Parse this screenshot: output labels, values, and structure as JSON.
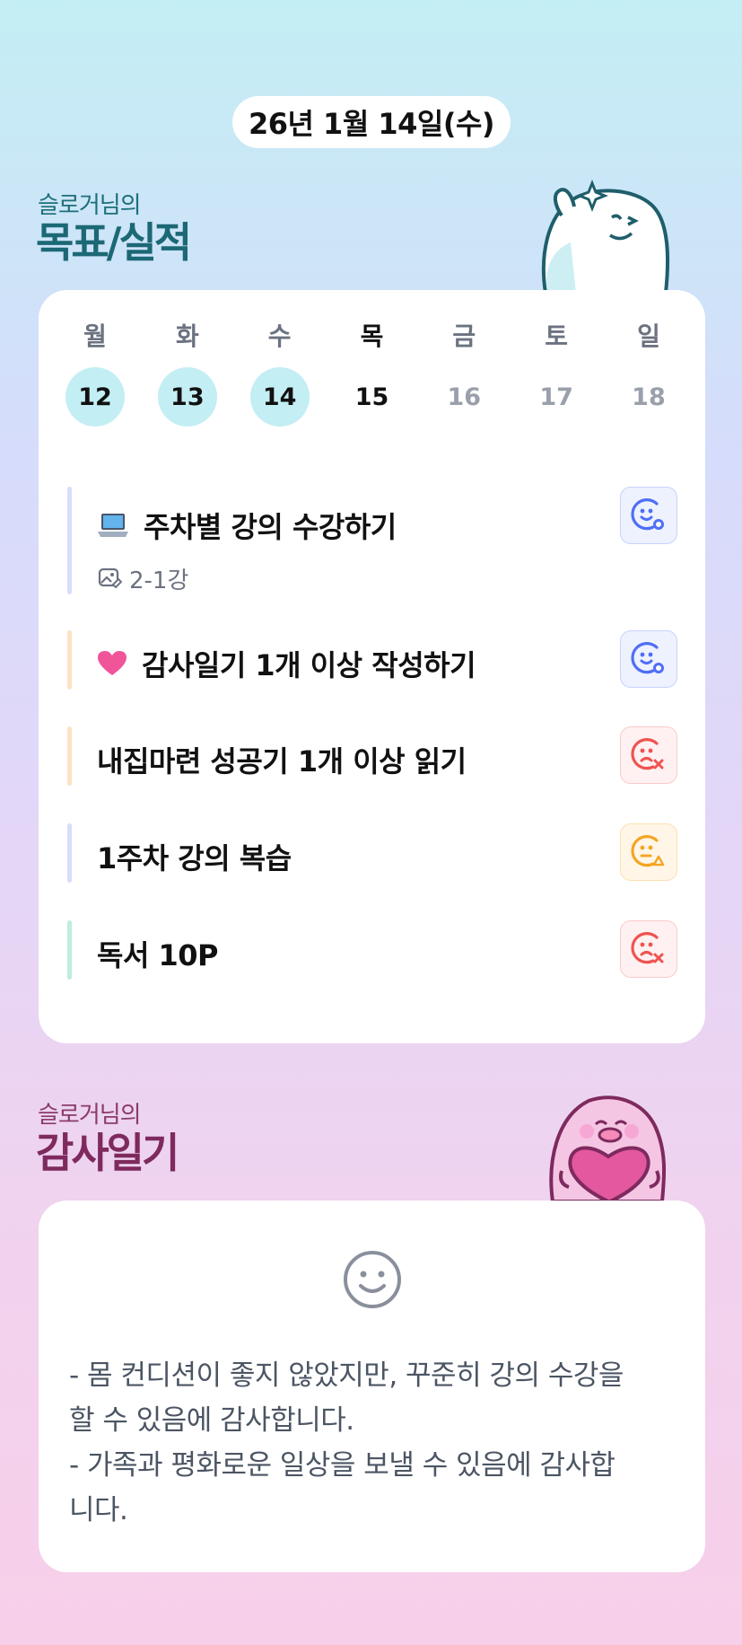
{
  "header": {
    "date": "26년 1월 14일(수)"
  },
  "goals_section": {
    "subtitle": "슬로거님의",
    "title": "목표/실적"
  },
  "week": [
    {
      "name": "월",
      "num": "12",
      "done": true,
      "current": false
    },
    {
      "name": "화",
      "num": "13",
      "done": true,
      "current": false
    },
    {
      "name": "수",
      "num": "14",
      "done": true,
      "current": false
    },
    {
      "name": "목",
      "num": "15",
      "done": false,
      "current": true
    },
    {
      "name": "금",
      "num": "16",
      "done": false,
      "current": false
    },
    {
      "name": "토",
      "num": "17",
      "done": false,
      "current": false
    },
    {
      "name": "일",
      "num": "18",
      "done": false,
      "current": false
    }
  ],
  "goals": [
    {
      "emoji": "laptop-icon",
      "text": "주차별 강의 수강하기",
      "sub": "2-1강",
      "bar_color": "#d6defa",
      "status": "good"
    },
    {
      "emoji": "heart-icon",
      "text": "감사일기 1개 이상 작성하기",
      "sub": "",
      "bar_color": "#fde3c4",
      "status": "good"
    },
    {
      "emoji": "",
      "text": "내집마련 성공기 1개 이상 읽기",
      "sub": "",
      "bar_color": "#fde3c4",
      "status": "bad"
    },
    {
      "emoji": "",
      "text": "1주차 강의 복습",
      "sub": "",
      "bar_color": "#d6defa",
      "status": "mid"
    },
    {
      "emoji": "",
      "text": "독서 10P",
      "sub": "",
      "bar_color": "#bfeedd",
      "status": "bad"
    }
  ],
  "gratitude_section": {
    "subtitle": "슬로거님의",
    "title": "감사일기"
  },
  "gratitude": {
    "face": "smile-icon",
    "text": "- 몸 컨디션이 좋지 않았지만, 꾸준히 강의 수강을\n할 수 있음에 감사합니다.\n- 가족과 평화로운 일상을 보낼 수 있음에 감사합\n니다."
  },
  "colors": {
    "good": "#4f6ef7",
    "bad": "#ef5350",
    "mid": "#f5a524"
  }
}
